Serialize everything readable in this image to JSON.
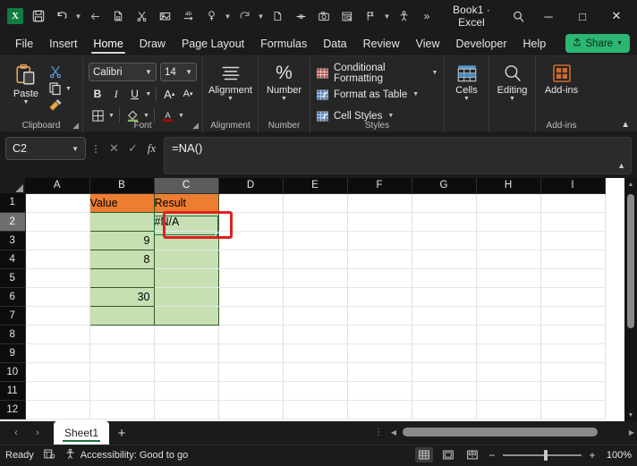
{
  "titlebar": {
    "app_logo": "excel-logo",
    "title": "Book1  ·  Excel",
    "qat": [
      {
        "name": "save-icon",
        "glyph": "💾"
      },
      {
        "name": "undo-icon",
        "glyph": "↶",
        "caret": true
      },
      {
        "name": "back-icon",
        "glyph": "←"
      },
      {
        "name": "copy-icon",
        "glyph": "❐"
      },
      {
        "name": "cut-icon",
        "glyph": "✂"
      },
      {
        "name": "paste-special-icon",
        "glyph": "✎"
      },
      {
        "name": "spelling-icon",
        "glyph": "ab"
      },
      {
        "name": "format-painter-icon",
        "glyph": "☝",
        "caret": true
      },
      {
        "name": "redo-icon",
        "glyph": "↷",
        "caret": true
      },
      {
        "name": "new-file-icon",
        "glyph": "☐"
      },
      {
        "name": "ink-icon",
        "glyph": "✒"
      },
      {
        "name": "screenshot-icon",
        "glyph": "📷"
      },
      {
        "name": "print-preview-icon",
        "glyph": "⌗"
      },
      {
        "name": "sort-filter-icon",
        "glyph": "⚑",
        "caret": true
      },
      {
        "name": "accessibility-icon",
        "glyph": "⛹"
      },
      {
        "name": "more-commands-icon",
        "glyph": "»"
      }
    ],
    "search_icon": "search-icon",
    "minimize": "─",
    "maximize": "□",
    "close": "✕"
  },
  "ribbon_tabs": {
    "items": [
      {
        "label": "File",
        "active": false
      },
      {
        "label": "Insert",
        "active": false
      },
      {
        "label": "Home",
        "active": true
      },
      {
        "label": "Draw",
        "active": false
      },
      {
        "label": "Page Layout",
        "active": false
      },
      {
        "label": "Formulas",
        "active": false
      },
      {
        "label": "Data",
        "active": false
      },
      {
        "label": "Review",
        "active": false
      },
      {
        "label": "View",
        "active": false
      },
      {
        "label": "Developer",
        "active": false
      },
      {
        "label": "Help",
        "active": false
      }
    ],
    "share": {
      "label": "Share",
      "icon": "share-icon",
      "color": "#2bb673"
    }
  },
  "ribbon": {
    "clipboard": {
      "group_label": "Clipboard",
      "paste_label": "Paste",
      "cut_icon": "scissors-icon",
      "copy_icon": "copy-icon",
      "format_painter_icon": "paintbrush-icon",
      "launcher": "dialog-launcher-icon"
    },
    "font": {
      "group_label": "Font",
      "font_name": "Calibri",
      "font_size": "14",
      "bold": "B",
      "italic": "I",
      "underline": "U",
      "grow_font": "A",
      "shrink_font": "A",
      "borders_icon": "borders-icon",
      "fill_color_icon": "fill-color-icon",
      "font_color_icon": "font-color-icon",
      "launcher": "dialog-launcher-icon"
    },
    "alignment": {
      "group_label": "Alignment",
      "label": "Alignment"
    },
    "number": {
      "group_label": "Number",
      "label": "Number",
      "symbol": "%"
    },
    "styles": {
      "group_label": "Styles",
      "items": [
        {
          "label": "Conditional Formatting",
          "icon": "conditional-formatting-icon"
        },
        {
          "label": "Format as Table",
          "icon": "format-as-table-icon"
        },
        {
          "label": "Cell Styles",
          "icon": "cell-styles-icon"
        }
      ]
    },
    "cells": {
      "label": "Cells",
      "icon": "cells-icon"
    },
    "editing": {
      "label": "Editing",
      "icon": "editing-magnifier-icon"
    },
    "addins": {
      "group_label": "Add-ins",
      "label": "Add-ins",
      "icon": "addins-icon"
    },
    "collapse_icon": "collapse-ribbon-icon"
  },
  "formula_bar": {
    "name_box": "C2",
    "cancel_icon": "cancel-icon",
    "enter_icon": "enter-icon",
    "fx_icon": "insert-function-icon",
    "formula": "=NA()",
    "expand_icon": "expand-formula-bar-icon"
  },
  "grid": {
    "columns": [
      "A",
      "B",
      "C",
      "D",
      "E",
      "F",
      "G",
      "H",
      "I"
    ],
    "selected_column": "C",
    "selected_row": 2,
    "rows": [
      1,
      2,
      3,
      4,
      5,
      6,
      7,
      8,
      9,
      10,
      11,
      12
    ],
    "cells": {
      "B1": "Value",
      "C1": "Result",
      "B2": "",
      "C2": "#N/A",
      "B3": "9",
      "C3": "",
      "B4": "8",
      "C4": "",
      "B5": "",
      "C5": "",
      "B6": "30",
      "C6": "",
      "B7": "",
      "C7": ""
    },
    "colors": {
      "header_fill": "#ED7D31",
      "data_fill": "#C6E0B4",
      "table_border": "#375623",
      "selection": "#217346",
      "annotation": "#e02020"
    },
    "active_cell": "C2"
  },
  "sheet_tabs": {
    "prev_icon": "prev-sheet-icon",
    "next_icon": "next-sheet-icon",
    "tabs": [
      {
        "label": "Sheet1",
        "active": true
      }
    ],
    "add_icon": "add-sheet-icon"
  },
  "status_bar": {
    "mode": "Ready",
    "accessibility_icon": "accessibility-icon",
    "record_macro_icon": "record-macro-icon",
    "accessibility_text": "Accessibility: Good to go",
    "views": [
      {
        "name": "normal-view-icon",
        "active": true
      },
      {
        "name": "page-layout-view-icon",
        "active": false
      },
      {
        "name": "page-break-view-icon",
        "active": false
      }
    ],
    "zoom_out": "−",
    "zoom_in": "+",
    "zoom_level": "100%"
  }
}
